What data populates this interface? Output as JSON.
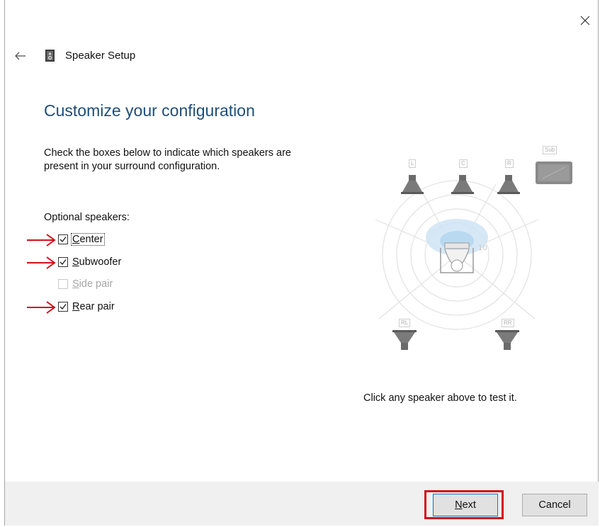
{
  "window": {
    "title": "Speaker Setup",
    "icons": {
      "close": "close-icon",
      "back": "back-arrow-icon",
      "app": "speaker-setup-icon"
    }
  },
  "main": {
    "heading": "Customize your configuration",
    "instructions": "Check the boxes below to indicate which speakers are present in your surround configuration.",
    "optional_label": "Optional speakers:",
    "options": [
      {
        "access_key": "C",
        "label_rest": "enter",
        "checked": true,
        "enabled": true,
        "focused": true,
        "annotated": true
      },
      {
        "access_key": "S",
        "label_rest": "ubwoofer",
        "checked": true,
        "enabled": true,
        "focused": false,
        "annotated": true
      },
      {
        "access_key": "S",
        "label_rest": "ide pair",
        "checked": false,
        "enabled": false,
        "focused": false,
        "annotated": false
      },
      {
        "access_key": "R",
        "label_rest": "ear pair",
        "checked": true,
        "enabled": true,
        "focused": false,
        "annotated": true
      }
    ]
  },
  "diagram": {
    "speakers": {
      "left": "L",
      "center": "C",
      "right": "R",
      "subwoofer": "Sub",
      "rear_left": "RL",
      "rear_right": "RR"
    },
    "test_hint": "Click any speaker above to test it."
  },
  "footer": {
    "next": {
      "access_key": "N",
      "rest": "ext"
    },
    "cancel": "Cancel"
  },
  "annotations": {
    "color": "#d0101c"
  },
  "colors": {
    "heading": "#1e4e79",
    "accent": "#0078d7",
    "footer_bg": "#f0f0f0"
  }
}
